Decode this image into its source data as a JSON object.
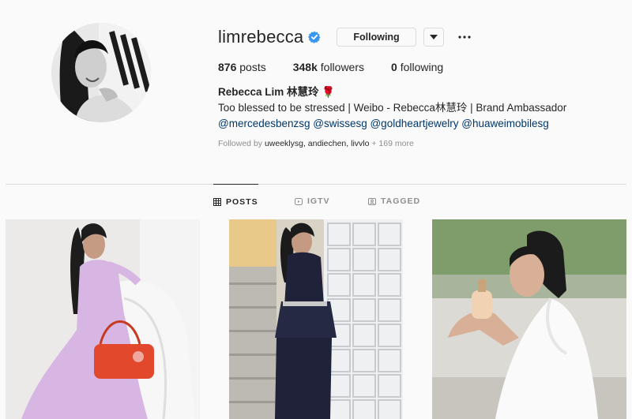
{
  "profile": {
    "username": "limrebecca",
    "follow_button": "Following",
    "stats": {
      "posts": "876",
      "posts_label": "posts",
      "followers": "348k",
      "followers_label": "followers",
      "following": "0",
      "following_label": "following"
    },
    "full_name": "Rebecca Lim 林慧玲 🌹",
    "bio_line": "Too blessed to be stressed | Weibo - Rebecca林慧玲 | Brand Ambassador",
    "bio_tags": "@mercedesbenzsg @swissesg @goldheartjewelry @huaweimobilesg",
    "followed_by_prefix": "Followed by",
    "followed_by_names": "uweeklysg, andiechen, livvlo",
    "followed_by_more": "+ 169 more"
  },
  "tabs": [
    {
      "label": "POSTS",
      "icon": "grid-icon",
      "active": true
    },
    {
      "label": "IGTV",
      "icon": "igtv-icon",
      "active": false
    },
    {
      "label": "TAGGED",
      "icon": "tagged-icon",
      "active": false
    }
  ],
  "colors": {
    "background": "#fafafa",
    "verified": "#3897f0",
    "link": "#00376b",
    "muted": "#8e8e8e"
  }
}
